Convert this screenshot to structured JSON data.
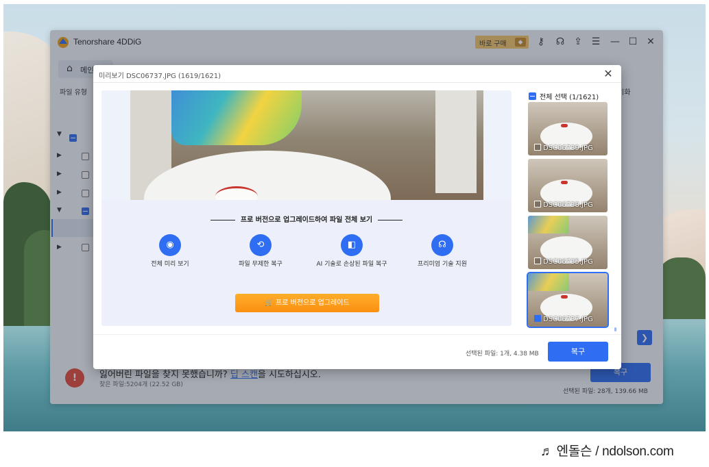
{
  "app": {
    "name": "Tenorshare 4DDiG",
    "buy_label": "바로 구매",
    "home_label": "메인",
    "filter_label": "파일 유형",
    "right_tab_partial": "기화",
    "bottom_message_prefix": "잃어버린 파일을 찾지 못했습니까?",
    "bottom_message_link": "딥 스캔",
    "bottom_message_suffix": "을 시도하십시오.",
    "bottom_found": "찾은 파일:5204개 (22.52 GB)",
    "recover_label": "복구",
    "selected_summary": "선택된 파일: 28개, 139.66 MB"
  },
  "dialog": {
    "title": "미리보기  DSC06737.JPG (1619/1621)",
    "upsell_title": "프로 버전으로 업그레이드하여 파일 전체 보기",
    "features": [
      {
        "icon": "eye-icon",
        "label": "전체 미리 보기"
      },
      {
        "icon": "recover-icon",
        "label": "파일 무제한 복구"
      },
      {
        "icon": "ai-repair-icon",
        "label": "AI 기술로 손상된 파일 복구"
      },
      {
        "icon": "headset-icon",
        "label": "프리미엄 기술 지원"
      }
    ],
    "upgrade_label": "🛒 프로 버전으로 업그레이드",
    "select_all_label": "전체 선택 (1/1621)",
    "thumbnails": [
      {
        "name": "DSC06739.JPG",
        "checked": false
      },
      {
        "name": "DSC06738.JPG",
        "checked": false
      },
      {
        "name": "DSC06735.JPG",
        "checked": false
      },
      {
        "name": "DSC06737.JPG",
        "checked": true
      }
    ],
    "selected_summary": "선택된 파일: 1개, 4.38 MB",
    "recover_label": "복구"
  },
  "watermark": "♬ 엔돌슨 / ndolson.com",
  "colors": {
    "accent": "#2f6ef2",
    "upgrade": "#fb8f12",
    "buy": "#f4c66a",
    "error": "#e54a3b"
  }
}
